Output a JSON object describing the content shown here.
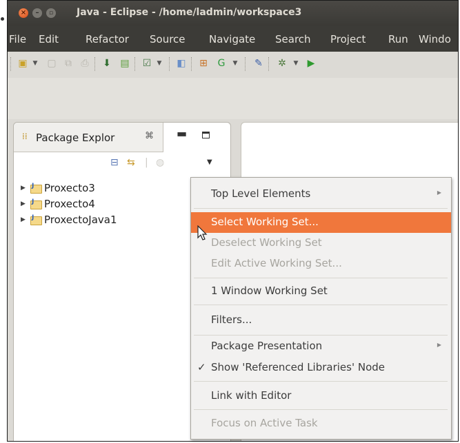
{
  "window": {
    "title": "Java - Eclipse - /home/ladmin/workspace3"
  },
  "menubar": [
    "File",
    "Edit",
    "Refactor",
    "Source",
    "Navigate",
    "Search",
    "Project",
    "Run",
    "Windo"
  ],
  "package_explorer": {
    "tab_label": "Package Explor",
    "projects": [
      "Proxecto3",
      "Proxecto4",
      "ProxectoJava1"
    ]
  },
  "context_menu": {
    "items": [
      {
        "label": "Top Level Elements",
        "state": "enabled",
        "submenu": true
      },
      {
        "label": "Select Working Set...",
        "state": "highlighted"
      },
      {
        "label": "Deselect Working Set",
        "state": "disabled"
      },
      {
        "label": "Edit Active Working Set...",
        "state": "disabled"
      },
      {
        "label": "1 Window Working Set",
        "state": "enabled"
      },
      {
        "label": "Filters...",
        "state": "enabled"
      },
      {
        "label": "Package Presentation",
        "state": "enabled",
        "submenu": true
      },
      {
        "label": "Show 'Referenced Libraries' Node",
        "state": "checked"
      },
      {
        "label": "Link with Editor",
        "state": "enabled"
      },
      {
        "label": "Focus on Active Task",
        "state": "disabled"
      }
    ]
  },
  "colors": {
    "title_bar": "#3b3a36",
    "menu_highlight": "#f0773c",
    "close_button": "#e05a22"
  },
  "icons": {
    "tab": "package-explorer-icon",
    "close": "close-icon",
    "submenu": "chevron-right-icon",
    "check": "check-icon"
  }
}
